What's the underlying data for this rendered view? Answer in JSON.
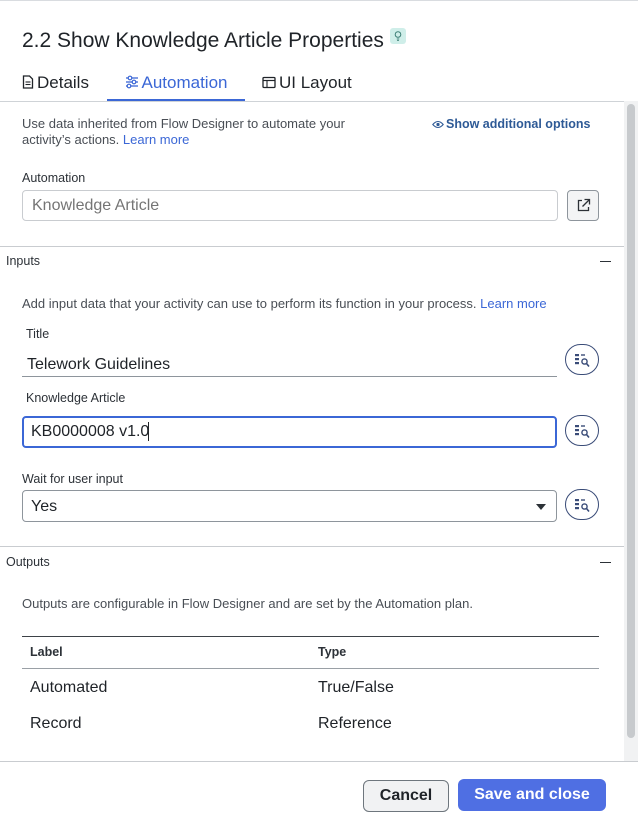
{
  "header": {
    "title": "2.2 Show Knowledge Article Properties",
    "badge_icon": "lightbulb-icon"
  },
  "tabs": [
    {
      "label": "Details",
      "icon": "document-icon",
      "active": false
    },
    {
      "label": "Automation",
      "icon": "sliders-icon",
      "active": true
    },
    {
      "label": "UI Layout",
      "icon": "layout-window-icon",
      "active": false
    }
  ],
  "automation": {
    "help_text_1": "Use data inherited from Flow Designer to automate your",
    "help_text_2": "activity’s actions.",
    "learn_more": "Learn more",
    "show_options": "Show additional options",
    "field_label": "Automation",
    "field_placeholder": "Knowledge Article"
  },
  "inputs": {
    "section_title": "Inputs",
    "help_text": "Add input data that your activity can use to perform its function in your process.",
    "learn_more": "Learn more",
    "title_label": "Title",
    "title_value": "Telework Guidelines",
    "kb_label": "Knowledge Article",
    "kb_value": "KB0000008 v1.0",
    "wait_label": "Wait for user input",
    "wait_value": "Yes"
  },
  "outputs": {
    "section_title": "Outputs",
    "help_text": "Outputs are configurable in Flow Designer and are set by the Automation plan.",
    "columns": [
      "Label",
      "Type"
    ],
    "rows": [
      {
        "label": "Automated",
        "type": "True/False"
      },
      {
        "label": "Record",
        "type": "Reference"
      }
    ]
  },
  "footer": {
    "cancel_label": "Cancel",
    "save_label": "Save and close"
  },
  "colors": {
    "accent": "#3b67d6",
    "primary_button": "#4f6fe3",
    "badge": "#cfeee9"
  }
}
